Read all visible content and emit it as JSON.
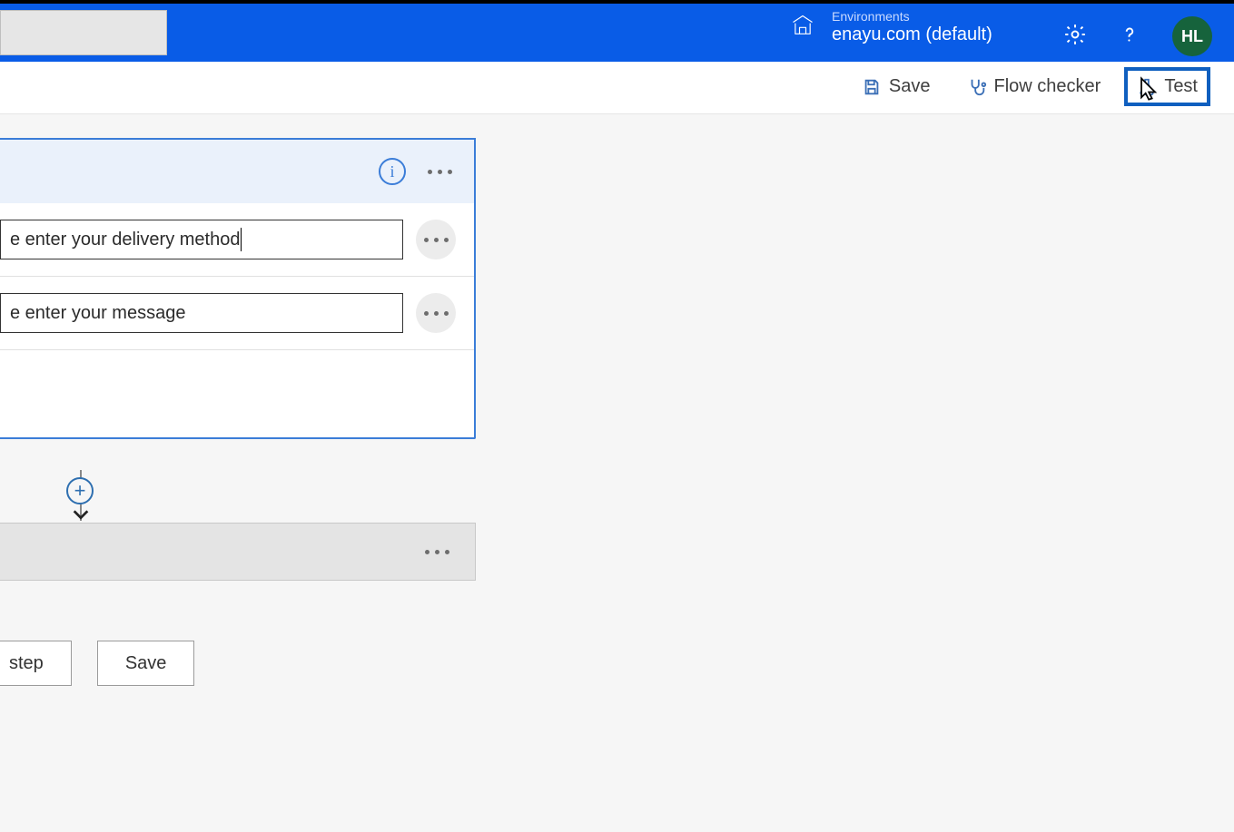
{
  "header": {
    "environments_label": "Environments",
    "environment_name": "enayu.com (default)",
    "avatar_initials": "HL"
  },
  "commandbar": {
    "save_label": "Save",
    "flow_checker_label": "Flow checker",
    "test_label": "Test"
  },
  "trigger_card": {
    "inputs": [
      {
        "value": "e enter your delivery method",
        "has_caret": true
      },
      {
        "value": "e enter your message",
        "has_caret": false
      }
    ]
  },
  "footer": {
    "new_step_label_partial": "step",
    "save_label": "Save"
  }
}
